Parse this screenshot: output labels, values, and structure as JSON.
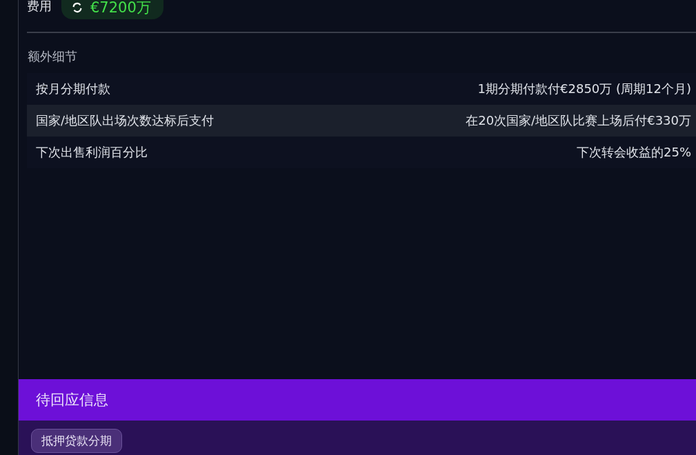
{
  "fee": {
    "label": "费用",
    "value": "€7200万"
  },
  "extra_details": {
    "title": "额外细节",
    "rows": [
      {
        "label": "按月分期付款",
        "value": "1期分期付款付€2850万 (周期12个月)",
        "highlighted": false
      },
      {
        "label": "国家/地区队出场次数达标后支付",
        "value": "在20次国家/地区队比赛上场后付€330万",
        "highlighted": true
      },
      {
        "label": "下次出售利润百分比",
        "value": "下次转会收益的25%",
        "highlighted": false
      }
    ]
  },
  "pending": {
    "title": "待回应信息",
    "buttons": [
      "抵押贷款分期"
    ]
  }
}
